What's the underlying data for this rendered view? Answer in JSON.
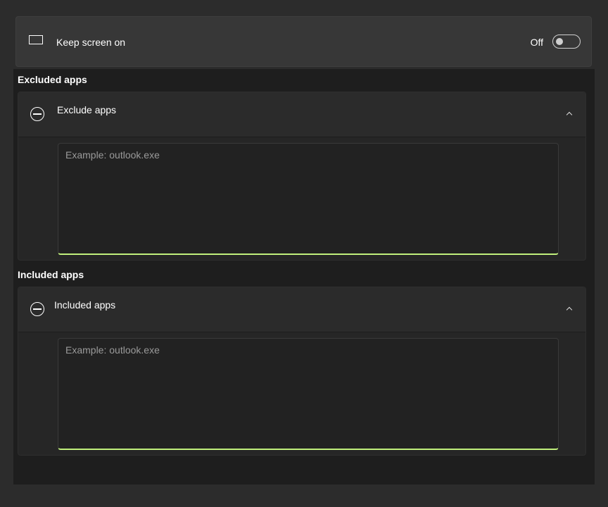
{
  "keep_screen": {
    "label": "Keep screen on",
    "toggle_state": "Off",
    "icon": "monitor-icon"
  },
  "excluded": {
    "section_title": "Excluded apps",
    "expander_label": "Exclude apps",
    "placeholder": "Example: outlook.exe",
    "icon": "minus-circle-icon"
  },
  "included": {
    "section_title": "Included apps",
    "expander_label": "Included apps",
    "placeholder": "Example: outlook.exe",
    "icon": "minus-circle-icon"
  },
  "colors": {
    "accent": "#c1f07c",
    "background": "#2c2c2c",
    "panel": "#1e1e1e",
    "card": "#373737"
  }
}
